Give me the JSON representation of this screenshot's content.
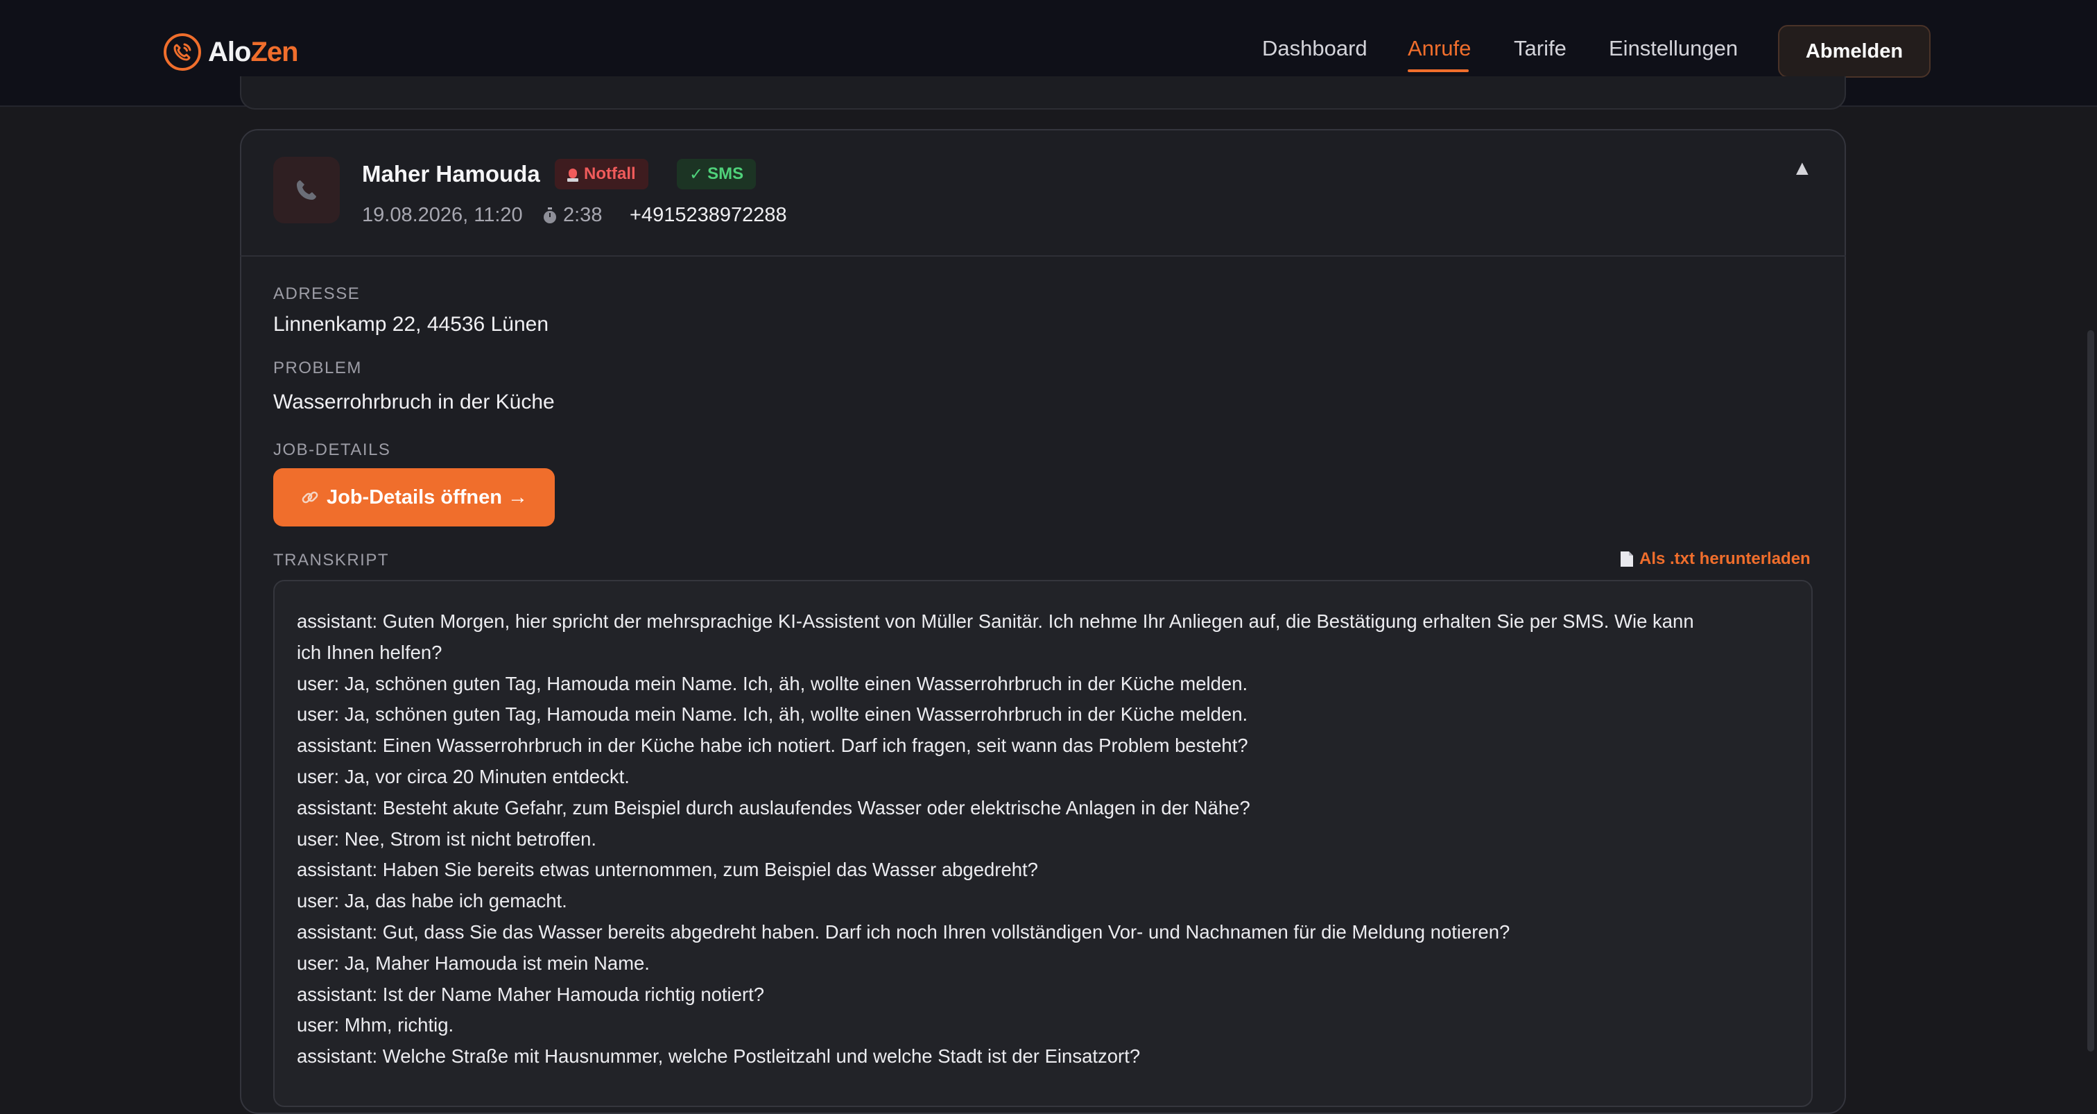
{
  "header": {
    "logo_part1": "Alo",
    "logo_part2": "Zen",
    "nav": [
      {
        "label": "Dashboard",
        "active": false
      },
      {
        "label": "Anrufe",
        "active": true
      },
      {
        "label": "Tarife",
        "active": false
      },
      {
        "label": "Einstellungen",
        "active": false
      }
    ],
    "logout_label": "Abmelden"
  },
  "call": {
    "name": "Maher Hamouda",
    "badge_emergency": "Notfall",
    "badge_sms": "SMS",
    "datetime": "19.08.2026, 11:20",
    "duration": "2:38",
    "phone": "+4915238972288",
    "collapse_icon": "▲"
  },
  "details": {
    "address_label": "ADRESSE",
    "address": "Linnenkamp 22, 44536 Lünen",
    "problem_label": "PROBLEM",
    "problem": "Wasserrohrbruch in der Küche",
    "job_label": "JOB-DETAILS",
    "job_button": "Job-Details öffnen →",
    "transcript_label": "TRANSKRIPT",
    "download_label": "Als .txt herunterladen"
  },
  "transcript": [
    "assistant: Guten Morgen, hier spricht der mehrsprachige KI-Assistent von Müller Sanitär. Ich nehme Ihr Anliegen auf, die Bestätigung erhalten Sie per SMS. Wie kann",
    "ich Ihnen helfen?",
    "user: Ja, schönen guten Tag, Hamouda mein Name. Ich, äh, wollte einen Wasserrohrbruch in der Küche melden.",
    "user: Ja, schönen guten Tag, Hamouda mein Name. Ich, äh, wollte einen Wasserrohrbruch in der Küche melden.",
    "assistant: Einen Wasserrohrbruch in der Küche habe ich notiert. Darf ich fragen, seit wann das Problem besteht?",
    "user: Ja, vor circa 20 Minuten entdeckt.",
    "assistant: Besteht akute Gefahr, zum Beispiel durch auslaufendes Wasser oder elektrische Anlagen in der Nähe?",
    "user: Nee, Strom ist nicht betroffen.",
    "assistant: Haben Sie bereits etwas unternommen, zum Beispiel das Wasser abgedreht?",
    "user: Ja, das habe ich gemacht.",
    "assistant: Gut, dass Sie das Wasser bereits abgedreht haben. Darf ich noch Ihren vollständigen Vor- und Nachnamen für die Meldung notieren?",
    "user: Ja, Maher Hamouda ist mein Name.",
    "assistant: Ist der Name Maher Hamouda richtig notiert?",
    "user: Mhm, richtig.",
    "assistant: Welche Straße mit Hausnummer, welche Postleitzahl und welche Stadt ist der Einsatzort?"
  ],
  "colors": {
    "accent": "#f06e2c",
    "background": "#19191d",
    "emergency": "#f05b5b",
    "sms": "#4fd17a"
  }
}
